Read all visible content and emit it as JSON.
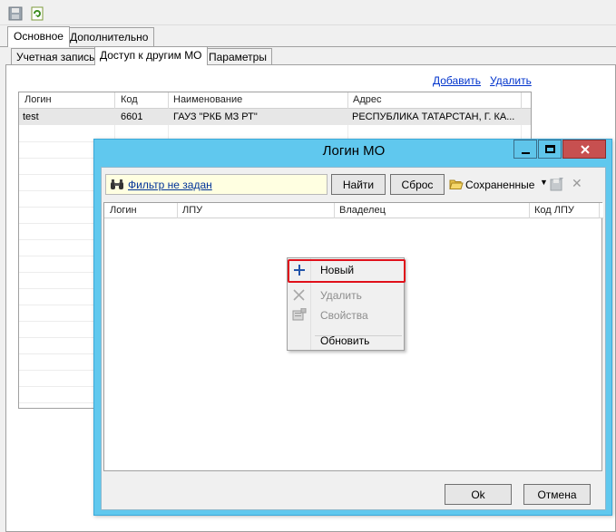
{
  "toolbar": {
    "icons": [
      "save-icon",
      "refresh-icon"
    ]
  },
  "tabs": [
    {
      "label": "Основное",
      "active": true
    },
    {
      "label": "Дополнительно",
      "active": false
    }
  ],
  "subtabs": [
    {
      "label": "Учетная запись",
      "active": false
    },
    {
      "label": "Доступ к другим МО",
      "active": true
    },
    {
      "label": "Параметры",
      "active": false
    }
  ],
  "actions": {
    "add": "Добавить",
    "delete": "Удалить"
  },
  "grid": {
    "columns": [
      "Логин",
      "Код",
      "Наименование",
      "Адрес"
    ],
    "rows": [
      [
        "test",
        "6601",
        "ГАУЗ \"РКБ МЗ РТ\"",
        "РЕСПУБЛИКА ТАТАРСТАН, Г. КА..."
      ]
    ]
  },
  "dialog": {
    "title": "Логин МО",
    "filter_label": "Фильтр не задан",
    "find_button": "Найти",
    "reset_button": "Сброс",
    "saved_label": "Сохраненные",
    "columns": [
      "Логин",
      "ЛПУ",
      "Владелец",
      "Код ЛПУ"
    ],
    "ok_button": "Ok",
    "cancel_button": "Отмена"
  },
  "context_menu": {
    "items": [
      {
        "label": "Новый",
        "enabled": true,
        "icon": "plus-icon"
      },
      {
        "label": "Удалить",
        "enabled": false,
        "icon": "delete-x-icon"
      },
      {
        "label": "Свойства",
        "enabled": false,
        "icon": "properties-icon"
      },
      {
        "label": "Обновить",
        "enabled": true,
        "icon": ""
      }
    ]
  },
  "colors": {
    "dialog_border": "#60c8ee",
    "close_button": "#c75050",
    "highlight": "#e0101a",
    "link": "#0033cc"
  }
}
